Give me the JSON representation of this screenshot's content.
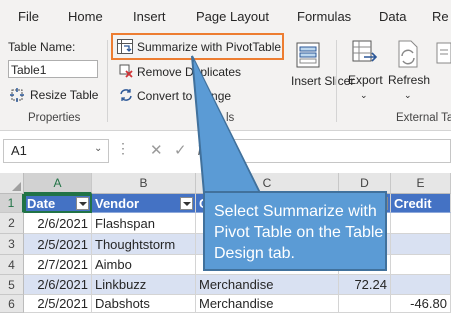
{
  "ribbon": {
    "tabs": [
      {
        "label": "File"
      },
      {
        "label": "Home"
      },
      {
        "label": "Insert"
      },
      {
        "label": "Page Layout"
      },
      {
        "label": "Formulas"
      },
      {
        "label": "Data"
      },
      {
        "label": "Re"
      }
    ],
    "properties": {
      "table_name_label": "Table Name:",
      "table_name_value": "Table1",
      "resize_table_label": "Resize Table",
      "group_label": "Properties"
    },
    "tools": {
      "summarize_label": "Summarize with PivotTable",
      "remove_duplicates_label": "Remove Duplicates",
      "convert_label": "Convert to Range",
      "group_label": "ls"
    },
    "insert_slicer_label": "Insert Slicer",
    "export_label": "Export",
    "refresh_label": "Refresh",
    "external_group_label": "External Ta"
  },
  "formula_bar": {
    "name_box": "A1",
    "fx": "fx",
    "value": ""
  },
  "sheet": {
    "columns": [
      "A",
      "B",
      "C",
      "D",
      "E"
    ],
    "row_numbers": [
      "1",
      "2",
      "3",
      "4",
      "5",
      "6"
    ],
    "headers": [
      "Date",
      "Vendor",
      "C",
      "",
      "Credit"
    ],
    "rows": [
      {
        "date": "2/6/2021",
        "vendor": "Flashspan",
        "category": "",
        "debit": "",
        "credit": ""
      },
      {
        "date": "2/5/2021",
        "vendor": "Thoughtstorm",
        "category": "",
        "debit": "",
        "credit": ""
      },
      {
        "date": "2/7/2021",
        "vendor": "Aimbo",
        "category": "",
        "debit": "",
        "credit": ""
      },
      {
        "date": "2/6/2021",
        "vendor": "Linkbuzz",
        "category": "Merchandise",
        "debit": "72.24",
        "credit": ""
      },
      {
        "date": "2/5/2021",
        "vendor": "Dabshots",
        "category": "Merchandise",
        "debit": "",
        "credit": "-46.80"
      }
    ]
  },
  "callout": {
    "text": "Select Summarize with Pivot Table on the Table Design tab."
  },
  "colors": {
    "accent": "#217346",
    "highlight": "#ed7d31",
    "table_header": "#4472c4",
    "table_band": "#d9e1f2",
    "callout_fill": "#5b9bd5"
  }
}
